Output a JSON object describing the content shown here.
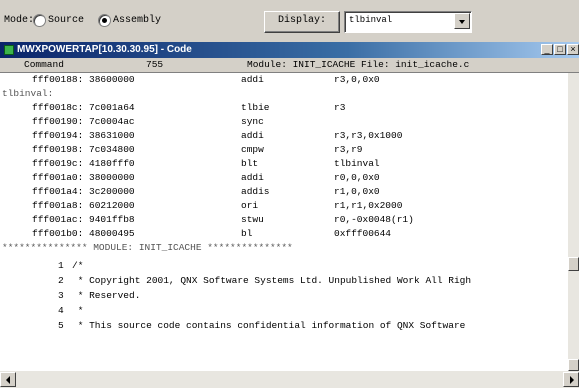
{
  "toolbar": {
    "mode_label": "Mode:",
    "source_label": "Source",
    "assembly_label": "Assembly",
    "selected_mode": "Assembly",
    "display_button": "Display:",
    "display_value": "tlbinval"
  },
  "window": {
    "title": "MWXPOWERTAP[10.30.30.95] - Code",
    "min": "_",
    "max": "□",
    "close": "×"
  },
  "columns": {
    "command": "Command",
    "number": "755",
    "module": "Module: INIT_ICACHE File: init_icache.c"
  },
  "asm_rows": [
    {
      "addr": "fff00188: 38600000",
      "op": "addi",
      "args": "r3,0,0x0"
    },
    {
      "label": "tlbinval:"
    },
    {
      "addr": "fff0018c: 7c001a64",
      "op": "tlbie",
      "args": "r3"
    },
    {
      "addr": "fff00190: 7c0004ac",
      "op": "sync",
      "args": ""
    },
    {
      "addr": "fff00194: 38631000",
      "op": "addi",
      "args": "r3,r3,0x1000"
    },
    {
      "addr": "fff00198: 7c034800",
      "op": "cmpw",
      "args": "r3,r9"
    },
    {
      "addr": "fff0019c: 4180fff0",
      "op": "blt",
      "args": "tlbinval"
    },
    {
      "addr": "fff001a0: 38000000",
      "op": "addi",
      "args": "r0,0,0x0"
    },
    {
      "addr": "fff001a4: 3c200000",
      "op": "addis",
      "args": "r1,0,0x0"
    },
    {
      "addr": "fff001a8: 60212000",
      "op": "ori",
      "args": "r1,r1,0x2000"
    },
    {
      "addr": "fff001ac: 9401ffb8",
      "op": "stwu",
      "args": "r0,-0x0048(r1)"
    },
    {
      "addr": "fff001b0: 48000495",
      "op": "bl",
      "args": "0xfff00644"
    },
    {
      "module_line": "*************** MODULE: INIT_ICACHE ***************"
    }
  ],
  "src_rows": [
    {
      "num": "1",
      "text": "/*"
    },
    {
      "num": "2",
      "text": " * Copyright 2001, QNX Software Systems Ltd. Unpublished Work All Righ"
    },
    {
      "num": "3",
      "text": " * Reserved."
    },
    {
      "num": "4",
      "text": " *"
    },
    {
      "num": "5",
      "text": " * This source code contains confidential information of QNX Software"
    }
  ]
}
